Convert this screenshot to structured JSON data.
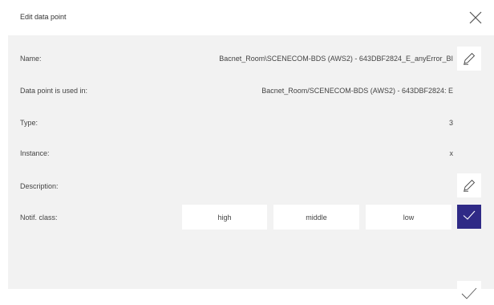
{
  "dialog": {
    "title": "Edit data point",
    "close_icon": "close-icon"
  },
  "fields": {
    "name": {
      "label": "Name:",
      "value": "Bacnet_Room\\SCENECOM-BDS (AWS2) - 643DBF2824_E_anyError_BI"
    },
    "used_in": {
      "label": "Data point is used in:",
      "value": "Bacnet_Room/SCENECOM-BDS (AWS2) - 643DBF2824: E"
    },
    "type": {
      "label": "Type:",
      "value": "3"
    },
    "instance": {
      "label": "Instance:",
      "value": "x"
    },
    "description": {
      "label": "Description:",
      "value": ""
    },
    "notif_class": {
      "label": "Notif. class:",
      "options": [
        "high",
        "middle",
        "low"
      ],
      "enabled": true
    }
  },
  "icons": {
    "edit": "pencil-icon",
    "check": "checkmark-icon",
    "confirm": "confirm-icon"
  },
  "colors": {
    "accent": "#2f2a86",
    "panel": "#f2f2f2",
    "header": "#ffffff"
  }
}
